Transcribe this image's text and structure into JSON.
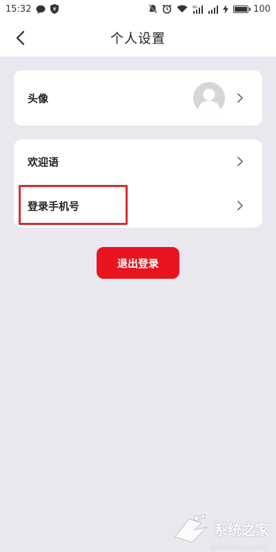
{
  "status_bar": {
    "time": "15:32",
    "battery_level": "100",
    "battery_fraction": 1.0
  },
  "header": {
    "title": "个人设置"
  },
  "avatar_card": {
    "label": "头像"
  },
  "settings_card": {
    "items": [
      {
        "label": "欢迎语"
      },
      {
        "label": "登录手机号"
      }
    ]
  },
  "logout_button": {
    "label": "退出登录"
  },
  "colors": {
    "accent": "#e9141f",
    "highlight": "#d9282e",
    "background": "#e9e8ee"
  },
  "watermark": {
    "text": "系统之家",
    "sub": "XITONGZHIJIA.NET"
  }
}
